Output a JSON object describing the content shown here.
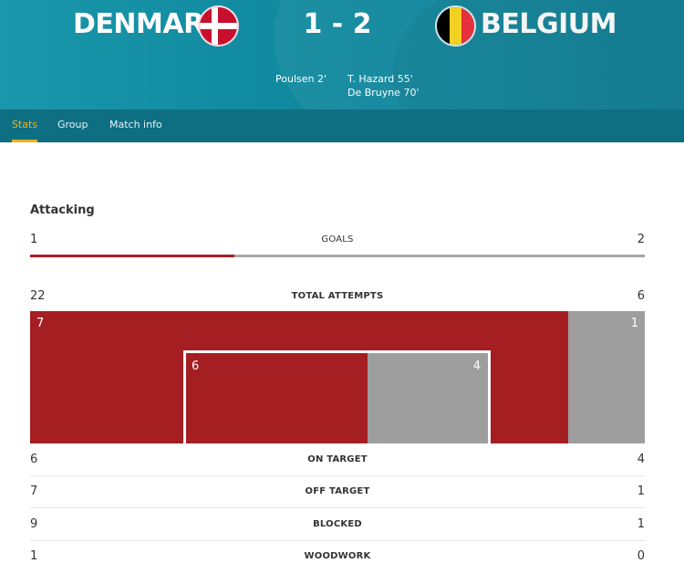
{
  "match": {
    "home": {
      "name": "DENMARK",
      "flag": "denmark-flag",
      "color": "#c8102e"
    },
    "away": {
      "name": "BELGIUM",
      "flag": "belgium-flag",
      "colors": [
        "#000000",
        "#fdda24",
        "#ef3340"
      ]
    },
    "score": "1 - 2",
    "home_scorers": "Poulsen 2'",
    "away_scorers": [
      "T. Hazard 55'",
      "De Bruyne 70'"
    ]
  },
  "tabs": [
    {
      "label": "Stats",
      "active": true
    },
    {
      "label": "Group",
      "active": false
    },
    {
      "label": "Match info",
      "active": false
    }
  ],
  "colors": {
    "home_bar": "#a51e22",
    "away_bar": "#9e9e9e",
    "active_tab": "#f2b01e",
    "header": "#0f889e"
  },
  "attacking": {
    "title": "Attacking",
    "goals": {
      "label": "GOALS",
      "home": "1",
      "away": "2",
      "home_share": 0.333
    },
    "total_attempts": {
      "label": "TOTAL ATTEMPTS",
      "home": "22",
      "away": "6"
    },
    "attempt_graphic": {
      "off_target_home": "7",
      "off_target_away": "1",
      "off_target_home_share": 0.875,
      "on_target_home": "6",
      "on_target_away": "4",
      "on_target_home_share": 0.6
    },
    "rows": [
      {
        "label": "ON TARGET",
        "home": "6",
        "away": "4"
      },
      {
        "label": "OFF TARGET",
        "home": "7",
        "away": "1"
      },
      {
        "label": "BLOCKED",
        "home": "9",
        "away": "1"
      },
      {
        "label": "WOODWORK",
        "home": "1",
        "away": "0"
      }
    ]
  }
}
